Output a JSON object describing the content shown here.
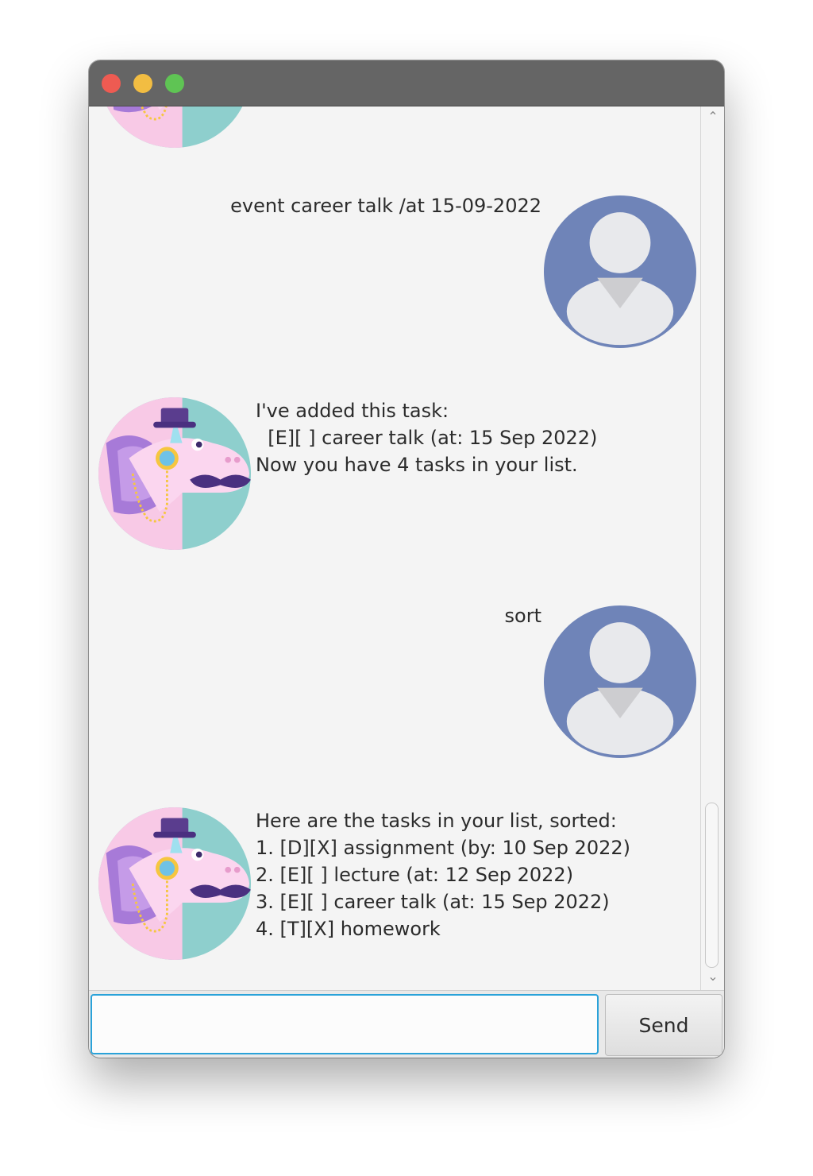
{
  "window": {
    "title": ""
  },
  "chat": {
    "messages": [
      {
        "sender": "user",
        "text": "event career talk /at 15-09-2022"
      },
      {
        "sender": "bot",
        "text": "I've added this task:\n  [E][ ] career talk (at: 15 Sep 2022)\nNow you have 4 tasks in your list."
      },
      {
        "sender": "user",
        "text": "sort"
      },
      {
        "sender": "bot",
        "text": "Here are the tasks in your list, sorted:\n1. [D][X] assignment (by: 10 Sep 2022)\n2. [E][ ] lecture (at: 12 Sep 2022)\n3. [E][ ] career talk (at: 15 Sep 2022)\n4. [T][X] homework"
      }
    ]
  },
  "input": {
    "value": "",
    "placeholder": ""
  },
  "send_button": {
    "label": "Send"
  },
  "icons": {
    "user_avatar": "user-avatar-icon",
    "bot_avatar": "unicorn-avatar-icon",
    "scroll_up": "chevron-up-icon",
    "scroll_down": "chevron-down-icon"
  },
  "colors": {
    "titlebar": "#656565",
    "close": "#ee5b52",
    "minimize": "#f2bd42",
    "zoom": "#5fc454",
    "input_focus": "#2aa2d9",
    "user_avatar_bg": "#6f84b8"
  }
}
